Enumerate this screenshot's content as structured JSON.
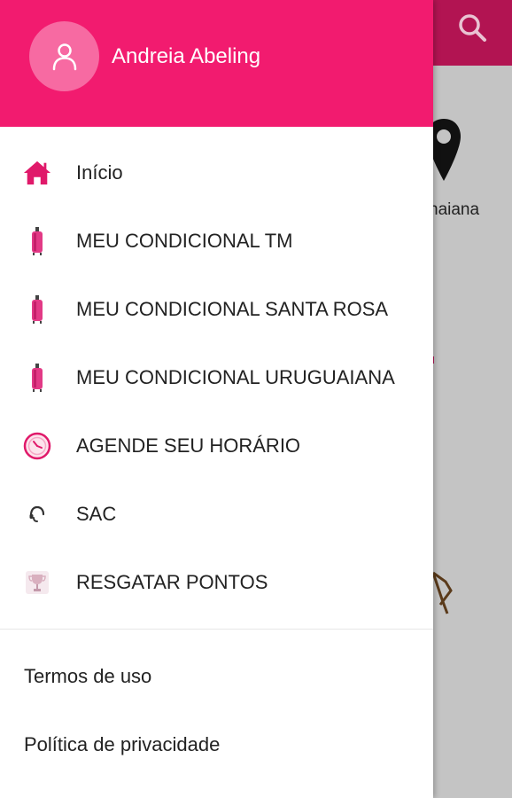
{
  "background": {
    "city_partial": "naiana"
  },
  "drawer": {
    "user_name": "Andreia Abeling",
    "menu": [
      {
        "label": "Início",
        "icon": "home-icon"
      },
      {
        "label": "MEU CONDICIONAL TM",
        "icon": "suitcase-icon"
      },
      {
        "label": "MEU CONDICIONAL SANTA ROSA",
        "icon": "suitcase-icon"
      },
      {
        "label": "MEU CONDICIONAL URUGUAIANA",
        "icon": "suitcase-icon"
      },
      {
        "label": "AGENDE SEU HORÁRIO",
        "icon": "clock-icon"
      },
      {
        "label": "SAC",
        "icon": "headset-icon"
      },
      {
        "label": "RESGATAR PONTOS",
        "icon": "trophy-icon"
      }
    ],
    "footer": [
      {
        "label": "Termos de uso"
      },
      {
        "label": "Política de privacidade"
      }
    ]
  },
  "colors": {
    "header": "#f21b6f",
    "avatar": "#f76aa2",
    "appbar_dimmed": "#b21452",
    "accent": "#e0196a"
  }
}
